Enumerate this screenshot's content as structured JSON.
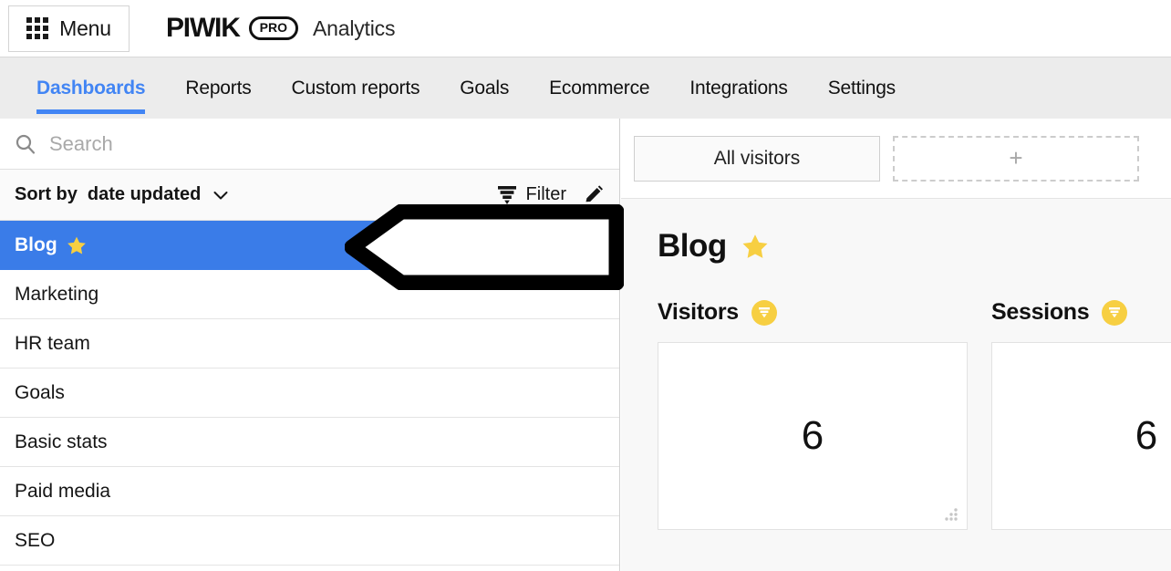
{
  "header": {
    "menu_label": "Menu",
    "menu_icon": "grid-icon",
    "brand_name": "PIWIK",
    "brand_badge": "PRO",
    "product_name": "Analytics"
  },
  "nav": {
    "tabs": [
      {
        "label": "Dashboards",
        "active": true
      },
      {
        "label": "Reports",
        "active": false
      },
      {
        "label": "Custom reports",
        "active": false
      },
      {
        "label": "Goals",
        "active": false
      },
      {
        "label": "Ecommerce",
        "active": false
      },
      {
        "label": "Integrations",
        "active": false
      },
      {
        "label": "Settings",
        "active": false
      }
    ],
    "active_color": "#4285f4"
  },
  "sidebar": {
    "search": {
      "placeholder": "Search",
      "value": "",
      "icon": "search-icon"
    },
    "sort": {
      "label": "Sort by",
      "value": "date updated",
      "chevron_icon": "chevron-down-icon"
    },
    "filter": {
      "label": "Filter",
      "icon": "funnel-icon"
    },
    "edit": {
      "icon": "pencil-icon"
    },
    "items": [
      {
        "label": "Blog",
        "starred": true,
        "selected": true
      },
      {
        "label": "Marketing",
        "starred": false,
        "selected": false
      },
      {
        "label": "HR team",
        "starred": false,
        "selected": false
      },
      {
        "label": "Goals",
        "starred": false,
        "selected": false
      },
      {
        "label": "Basic stats",
        "starred": false,
        "selected": false
      },
      {
        "label": "Paid media",
        "starred": false,
        "selected": false
      },
      {
        "label": "SEO",
        "starred": false,
        "selected": false
      }
    ],
    "selected_color": "#3a7ce8",
    "star_color": "#f7cf42"
  },
  "annotation": {
    "shape": "left-arrow-callout",
    "text": "",
    "stroke_color": "#000000",
    "fill_color": "#ffffff"
  },
  "main": {
    "segments": {
      "active_label": "All visitors",
      "add_label": "+"
    },
    "dashboard_title": "Blog",
    "dashboard_starred": true,
    "widgets": [
      {
        "title": "Visitors",
        "badge_icon": "funnel-icon",
        "value": "6",
        "has_grip": true
      },
      {
        "title": "Sessions",
        "badge_icon": "funnel-icon",
        "value": "6",
        "has_grip": false
      }
    ]
  }
}
